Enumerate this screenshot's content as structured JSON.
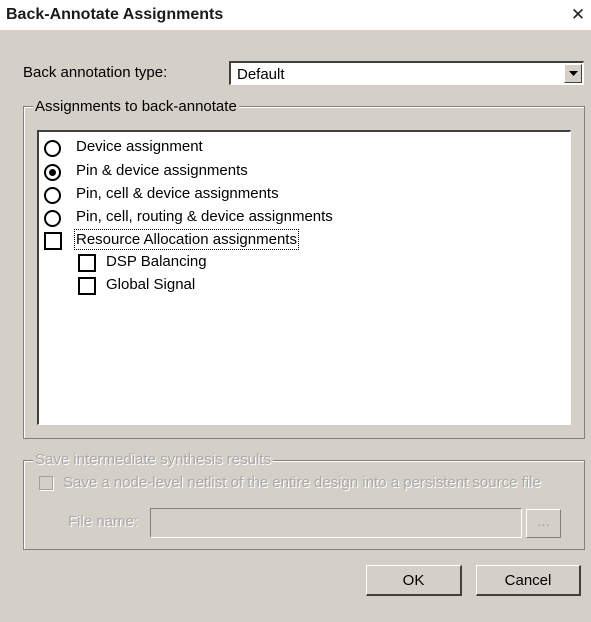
{
  "window": {
    "title": "Back-Annotate Assignments",
    "close_glyph": "✕"
  },
  "annotation_type": {
    "label": "Back annotation type:",
    "value": "Default"
  },
  "assignments_group": {
    "legend": "Assignments to back-annotate",
    "radios": [
      {
        "label": "Device assignment",
        "checked": false
      },
      {
        "label": "Pin & device assignments",
        "checked": true
      },
      {
        "label": "Pin, cell & device assignments",
        "checked": false
      },
      {
        "label": "Pin, cell, routing & device assignments",
        "checked": false
      }
    ],
    "resource_allocation": {
      "label": "Resource Allocation assignments",
      "checked": false
    },
    "sub_options": [
      {
        "label": "DSP Balancing",
        "checked": false
      },
      {
        "label": "Global Signal",
        "checked": false
      }
    ]
  },
  "synthesis_group": {
    "legend": "Save intermediate synthesis results",
    "checkbox_label": "Save a node-level netlist of the entire design into a persistent source file",
    "file_label": "File name:",
    "file_value": "",
    "browse_label": "..."
  },
  "buttons": {
    "ok": "OK",
    "cancel": "Cancel"
  }
}
